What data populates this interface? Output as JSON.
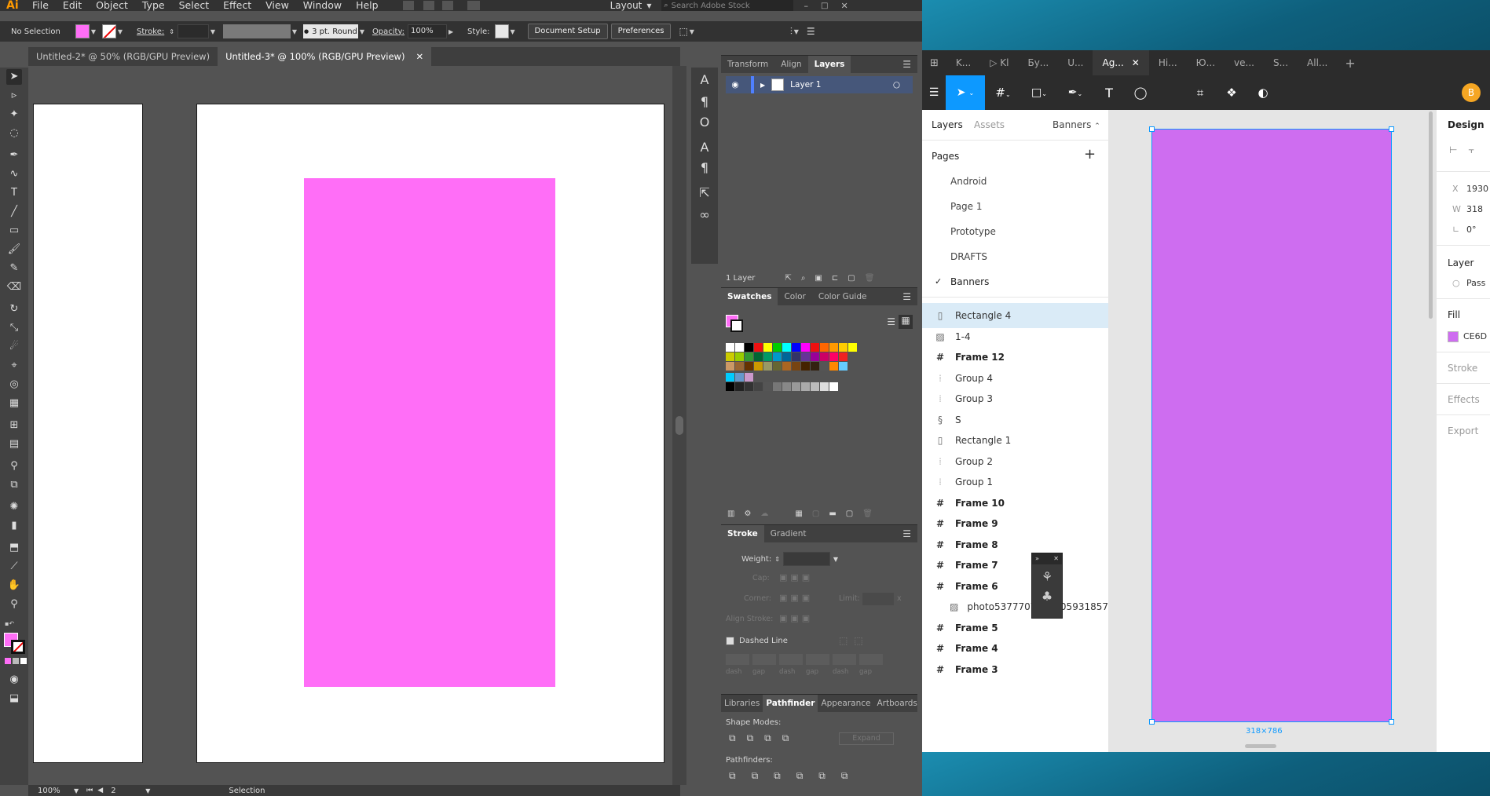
{
  "ai": {
    "logo": "Ai",
    "menu": [
      "File",
      "Edit",
      "Object",
      "Type",
      "Select",
      "Effect",
      "View",
      "Window",
      "Help"
    ],
    "workspace": "Layout",
    "search_placeholder": "Search Adobe Stock",
    "control": {
      "selection": "No Selection",
      "stroke_label": "Stroke:",
      "brush": "3 pt. Round",
      "opacity_label": "Opacity:",
      "opacity": "100%",
      "style_label": "Style:",
      "document_setup": "Document Setup",
      "preferences": "Preferences"
    },
    "fill_color": "#ff6ef7",
    "doc_tabs": [
      "Untitled-2* @ 50% (RGB/GPU Preview)",
      "Untitled-3* @ 100% (RGB/GPU Preview)"
    ],
    "status": {
      "zoom": "100%",
      "page": "2",
      "tool": "Selection"
    },
    "layers_panel": {
      "tabs": [
        "Transform",
        "Align",
        "Layers"
      ],
      "layer_name": "Layer 1",
      "count": "1 Layer"
    },
    "swatches_panel": {
      "tabs": [
        "Swatches",
        "Color",
        "Color Guide"
      ]
    },
    "stroke_panel": {
      "tabs": [
        "Stroke",
        "Gradient"
      ],
      "weight_label": "Weight:",
      "cap_label": "Cap:",
      "corner_label": "Corner:",
      "limit_label": "Limit:",
      "limit_unit": "x",
      "align_label": "Align Stroke:",
      "dashed_line": "Dashed Line",
      "dash_labels": [
        "dash",
        "gap",
        "dash",
        "gap",
        "dash",
        "gap"
      ]
    },
    "pathfinder_panel": {
      "tabs": [
        "Libraries",
        "Pathfinder",
        "Appearance",
        "Artboards"
      ],
      "shape_modes": "Shape Modes:",
      "expand": "Expand",
      "pathfinders": "Pathfinders:"
    }
  },
  "figma": {
    "tabs": [
      "K...",
      "Kl",
      "Бу...",
      "U...",
      "Ag...",
      "Hi...",
      "Ю...",
      "ve...",
      "S...",
      "All..."
    ],
    "avatar": "B",
    "left": {
      "tab_layers": "Layers",
      "tab_assets": "Assets",
      "current_page": "Banners",
      "pages_title": "Pages",
      "pages": [
        "Android",
        "Page 1",
        "Prototype",
        "DRAFTS",
        "Banners"
      ],
      "layers": [
        {
          "icon": "rect",
          "name": "Rectangle 4"
        },
        {
          "icon": "image",
          "name": "1-4"
        },
        {
          "icon": "frame",
          "name": "Frame 12"
        },
        {
          "icon": "group",
          "name": "Group 4"
        },
        {
          "icon": "group",
          "name": "Group 3"
        },
        {
          "icon": "component",
          "name": "S"
        },
        {
          "icon": "rect",
          "name": "Rectangle 1"
        },
        {
          "icon": "group",
          "name": "Group 2"
        },
        {
          "icon": "group",
          "name": "Group 1"
        },
        {
          "icon": "frame",
          "name": "Frame 10"
        },
        {
          "icon": "frame",
          "name": "Frame 9"
        },
        {
          "icon": "frame",
          "name": "Frame 8"
        },
        {
          "icon": "frame",
          "name": "Frame 7"
        },
        {
          "icon": "frame",
          "name": "Frame 6"
        },
        {
          "icon": "image",
          "name": "photo5377707789905931857"
        },
        {
          "icon": "frame",
          "name": "Frame 5"
        },
        {
          "icon": "frame",
          "name": "Frame 4"
        },
        {
          "icon": "frame",
          "name": "Frame 3"
        }
      ]
    },
    "canvas": {
      "size_label": "318×786",
      "rect_color": "#ce6df0"
    },
    "right": {
      "title": "Design",
      "x_label": "X",
      "x": "1930",
      "w_label": "W",
      "w": "318",
      "rot": "0°",
      "layer_title": "Layer",
      "blend": "Pass",
      "fill_title": "Fill",
      "fill_hex": "CE6D",
      "stroke_title": "Stroke",
      "effects_title": "Effects",
      "export_title": "Export"
    }
  }
}
